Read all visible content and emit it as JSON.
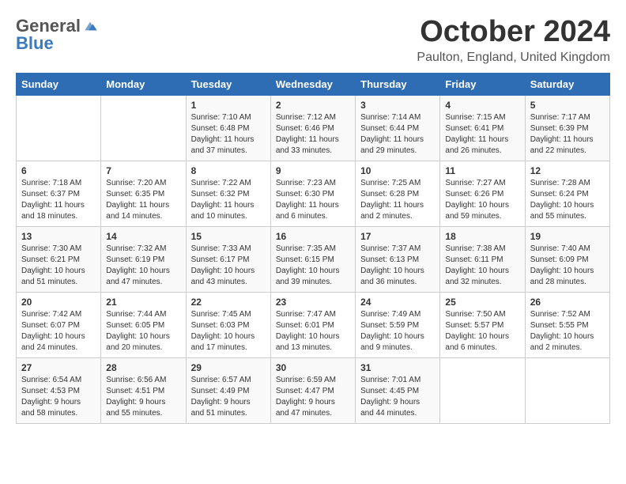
{
  "logo": {
    "general": "General",
    "blue": "Blue"
  },
  "title": "October 2024",
  "location": "Paulton, England, United Kingdom",
  "days_of_week": [
    "Sunday",
    "Monday",
    "Tuesday",
    "Wednesday",
    "Thursday",
    "Friday",
    "Saturday"
  ],
  "weeks": [
    [
      {
        "day": "",
        "sunrise": "",
        "sunset": "",
        "daylight": ""
      },
      {
        "day": "",
        "sunrise": "",
        "sunset": "",
        "daylight": ""
      },
      {
        "day": "1",
        "sunrise": "Sunrise: 7:10 AM",
        "sunset": "Sunset: 6:48 PM",
        "daylight": "Daylight: 11 hours and 37 minutes."
      },
      {
        "day": "2",
        "sunrise": "Sunrise: 7:12 AM",
        "sunset": "Sunset: 6:46 PM",
        "daylight": "Daylight: 11 hours and 33 minutes."
      },
      {
        "day": "3",
        "sunrise": "Sunrise: 7:14 AM",
        "sunset": "Sunset: 6:44 PM",
        "daylight": "Daylight: 11 hours and 29 minutes."
      },
      {
        "day": "4",
        "sunrise": "Sunrise: 7:15 AM",
        "sunset": "Sunset: 6:41 PM",
        "daylight": "Daylight: 11 hours and 26 minutes."
      },
      {
        "day": "5",
        "sunrise": "Sunrise: 7:17 AM",
        "sunset": "Sunset: 6:39 PM",
        "daylight": "Daylight: 11 hours and 22 minutes."
      }
    ],
    [
      {
        "day": "6",
        "sunrise": "Sunrise: 7:18 AM",
        "sunset": "Sunset: 6:37 PM",
        "daylight": "Daylight: 11 hours and 18 minutes."
      },
      {
        "day": "7",
        "sunrise": "Sunrise: 7:20 AM",
        "sunset": "Sunset: 6:35 PM",
        "daylight": "Daylight: 11 hours and 14 minutes."
      },
      {
        "day": "8",
        "sunrise": "Sunrise: 7:22 AM",
        "sunset": "Sunset: 6:32 PM",
        "daylight": "Daylight: 11 hours and 10 minutes."
      },
      {
        "day": "9",
        "sunrise": "Sunrise: 7:23 AM",
        "sunset": "Sunset: 6:30 PM",
        "daylight": "Daylight: 11 hours and 6 minutes."
      },
      {
        "day": "10",
        "sunrise": "Sunrise: 7:25 AM",
        "sunset": "Sunset: 6:28 PM",
        "daylight": "Daylight: 11 hours and 2 minutes."
      },
      {
        "day": "11",
        "sunrise": "Sunrise: 7:27 AM",
        "sunset": "Sunset: 6:26 PM",
        "daylight": "Daylight: 10 hours and 59 minutes."
      },
      {
        "day": "12",
        "sunrise": "Sunrise: 7:28 AM",
        "sunset": "Sunset: 6:24 PM",
        "daylight": "Daylight: 10 hours and 55 minutes."
      }
    ],
    [
      {
        "day": "13",
        "sunrise": "Sunrise: 7:30 AM",
        "sunset": "Sunset: 6:21 PM",
        "daylight": "Daylight: 10 hours and 51 minutes."
      },
      {
        "day": "14",
        "sunrise": "Sunrise: 7:32 AM",
        "sunset": "Sunset: 6:19 PM",
        "daylight": "Daylight: 10 hours and 47 minutes."
      },
      {
        "day": "15",
        "sunrise": "Sunrise: 7:33 AM",
        "sunset": "Sunset: 6:17 PM",
        "daylight": "Daylight: 10 hours and 43 minutes."
      },
      {
        "day": "16",
        "sunrise": "Sunrise: 7:35 AM",
        "sunset": "Sunset: 6:15 PM",
        "daylight": "Daylight: 10 hours and 39 minutes."
      },
      {
        "day": "17",
        "sunrise": "Sunrise: 7:37 AM",
        "sunset": "Sunset: 6:13 PM",
        "daylight": "Daylight: 10 hours and 36 minutes."
      },
      {
        "day": "18",
        "sunrise": "Sunrise: 7:38 AM",
        "sunset": "Sunset: 6:11 PM",
        "daylight": "Daylight: 10 hours and 32 minutes."
      },
      {
        "day": "19",
        "sunrise": "Sunrise: 7:40 AM",
        "sunset": "Sunset: 6:09 PM",
        "daylight": "Daylight: 10 hours and 28 minutes."
      }
    ],
    [
      {
        "day": "20",
        "sunrise": "Sunrise: 7:42 AM",
        "sunset": "Sunset: 6:07 PM",
        "daylight": "Daylight: 10 hours and 24 minutes."
      },
      {
        "day": "21",
        "sunrise": "Sunrise: 7:44 AM",
        "sunset": "Sunset: 6:05 PM",
        "daylight": "Daylight: 10 hours and 20 minutes."
      },
      {
        "day": "22",
        "sunrise": "Sunrise: 7:45 AM",
        "sunset": "Sunset: 6:03 PM",
        "daylight": "Daylight: 10 hours and 17 minutes."
      },
      {
        "day": "23",
        "sunrise": "Sunrise: 7:47 AM",
        "sunset": "Sunset: 6:01 PM",
        "daylight": "Daylight: 10 hours and 13 minutes."
      },
      {
        "day": "24",
        "sunrise": "Sunrise: 7:49 AM",
        "sunset": "Sunset: 5:59 PM",
        "daylight": "Daylight: 10 hours and 9 minutes."
      },
      {
        "day": "25",
        "sunrise": "Sunrise: 7:50 AM",
        "sunset": "Sunset: 5:57 PM",
        "daylight": "Daylight: 10 hours and 6 minutes."
      },
      {
        "day": "26",
        "sunrise": "Sunrise: 7:52 AM",
        "sunset": "Sunset: 5:55 PM",
        "daylight": "Daylight: 10 hours and 2 minutes."
      }
    ],
    [
      {
        "day": "27",
        "sunrise": "Sunrise: 6:54 AM",
        "sunset": "Sunset: 4:53 PM",
        "daylight": "Daylight: 9 hours and 58 minutes."
      },
      {
        "day": "28",
        "sunrise": "Sunrise: 6:56 AM",
        "sunset": "Sunset: 4:51 PM",
        "daylight": "Daylight: 9 hours and 55 minutes."
      },
      {
        "day": "29",
        "sunrise": "Sunrise: 6:57 AM",
        "sunset": "Sunset: 4:49 PM",
        "daylight": "Daylight: 9 hours and 51 minutes."
      },
      {
        "day": "30",
        "sunrise": "Sunrise: 6:59 AM",
        "sunset": "Sunset: 4:47 PM",
        "daylight": "Daylight: 9 hours and 47 minutes."
      },
      {
        "day": "31",
        "sunrise": "Sunrise: 7:01 AM",
        "sunset": "Sunset: 4:45 PM",
        "daylight": "Daylight: 9 hours and 44 minutes."
      },
      {
        "day": "",
        "sunrise": "",
        "sunset": "",
        "daylight": ""
      },
      {
        "day": "",
        "sunrise": "",
        "sunset": "",
        "daylight": ""
      }
    ]
  ]
}
